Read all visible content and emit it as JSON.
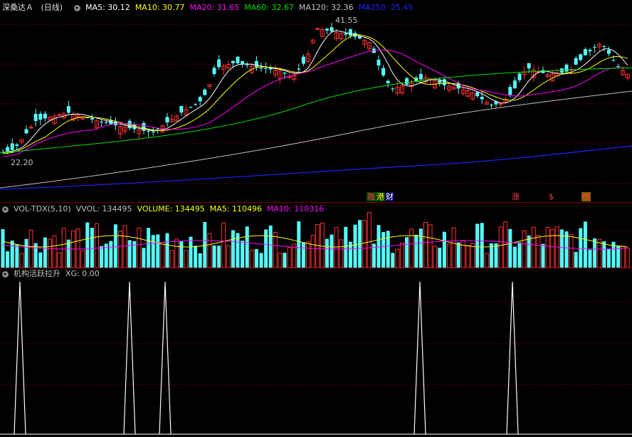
{
  "header": {
    "stock_name": "深桑达Ａ",
    "period": "(日线)",
    "indicators": [
      {
        "label": "MA5: 30.12",
        "color": "#ffffff"
      },
      {
        "label": "MA10: 30.77",
        "color": "#ffff00"
      },
      {
        "label": "MA20: 31.65",
        "color": "#ff00ff"
      },
      {
        "label": "MA60: 32.67",
        "color": "#00e000"
      },
      {
        "label": "MA120: 32.36",
        "color": "#c0c0c0"
      },
      {
        "label": "MA250: 25.45",
        "color": "#2020ff"
      }
    ],
    "high_label": "41.55",
    "low_label": "22.20"
  },
  "volume_header": {
    "name": "VOL-TDX(5,10)",
    "items": [
      {
        "label": "VVOL: 134495",
        "color": "#c0c0c0"
      },
      {
        "label": "VOLUME: 134495",
        "color": "#ffff00"
      },
      {
        "label": "MA5: 110496",
        "color": "#ffff00"
      },
      {
        "label": "MA10: 110316",
        "color": "#ff00ff"
      }
    ]
  },
  "xg_header": {
    "name": "机构活跃拉升",
    "value": "XG: 0.00"
  },
  "event_tags": [
    {
      "text": "融",
      "color": "#ff4040",
      "bg": "#004000"
    },
    {
      "text": "港",
      "color": "#ffff00",
      "bg": "#004000"
    },
    {
      "text": "财",
      "color": "#ffffff",
      "bg": "#000060"
    },
    {
      "text": "涨",
      "color": "#ff4040",
      "bg": "#000000"
    },
    {
      "text": "$",
      "color": "#ff4040",
      "bg": "#000000"
    },
    {
      "text": "榜",
      "color": "#ff4040",
      "bg": "#806000"
    }
  ],
  "chart_data": {
    "type": "candlestick",
    "y_range": [
      22.2,
      41.55
    ],
    "xg_signals": [
      1,
      1,
      1,
      1,
      1,
      1
    ],
    "colors": {
      "up": "#ff3030",
      "down": "#54ffff",
      "ma5": "#ffffff",
      "ma10": "#ffff00",
      "ma20": "#ff00ff",
      "ma60": "#00e000",
      "ma120": "#c0c0c0",
      "ma250": "#2020ff"
    }
  }
}
